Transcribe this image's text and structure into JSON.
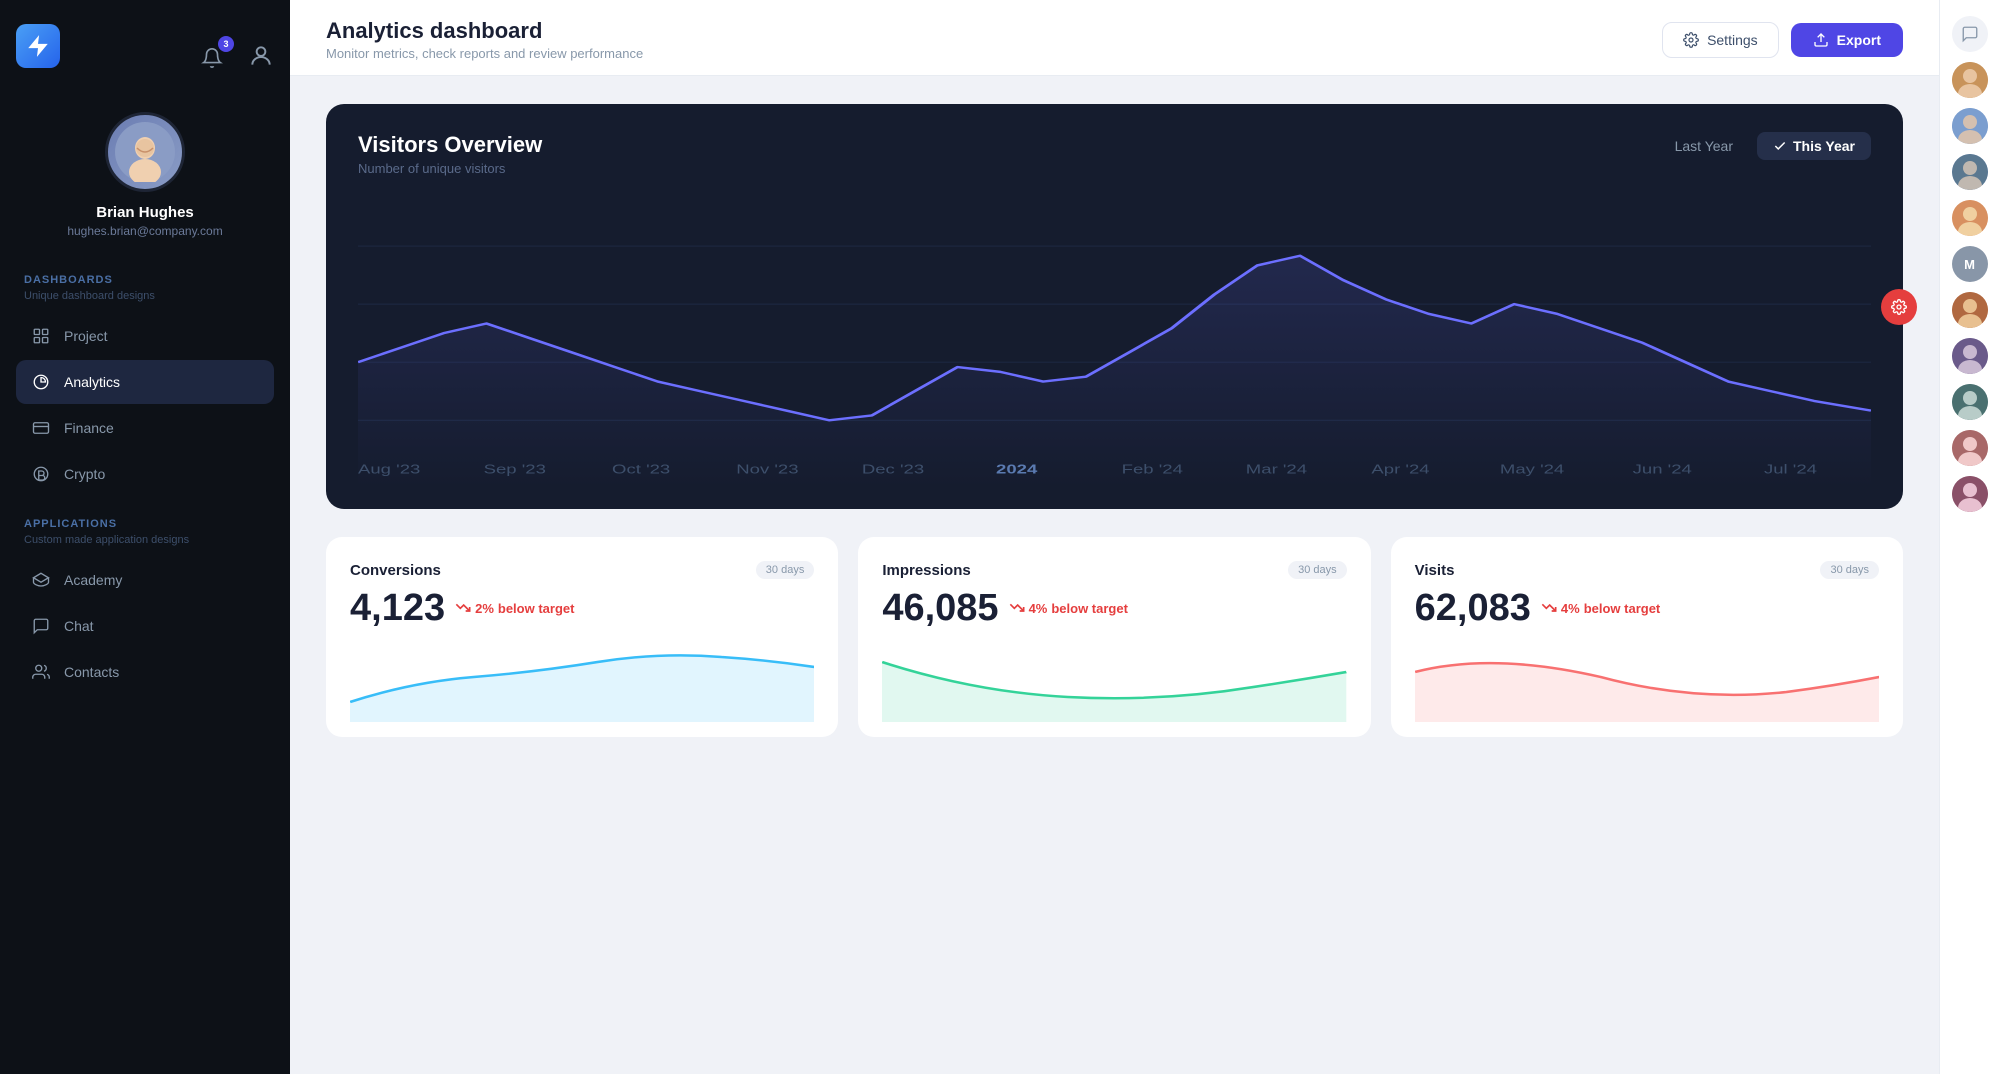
{
  "sidebar": {
    "logo_alt": "App Logo",
    "profile": {
      "name": "Brian Hughes",
      "email": "hughes.brian@company.com"
    },
    "dashboards_label": "DASHBOARDS",
    "dashboards_sub": "Unique dashboard designs",
    "applications_label": "APPLICATIONS",
    "applications_sub": "Custom made application designs",
    "nav_items": [
      {
        "id": "project",
        "label": "Project",
        "icon": "grid-icon"
      },
      {
        "id": "analytics",
        "label": "Analytics",
        "icon": "chart-icon",
        "active": true
      },
      {
        "id": "finance",
        "label": "Finance",
        "icon": "finance-icon"
      },
      {
        "id": "crypto",
        "label": "Crypto",
        "icon": "crypto-icon"
      }
    ],
    "app_items": [
      {
        "id": "academy",
        "label": "Academy",
        "icon": "academy-icon"
      },
      {
        "id": "chat",
        "label": "Chat",
        "icon": "chat-icon"
      },
      {
        "id": "contacts",
        "label": "Contacts",
        "icon": "contacts-icon"
      }
    ],
    "notification_count": "3"
  },
  "header": {
    "title": "Analytics dashboard",
    "subtitle": "Monitor metrics, check reports and review performance",
    "settings_label": "Settings",
    "export_label": "Export"
  },
  "chart": {
    "title": "Visitors Overview",
    "subtitle": "Number of unique visitors",
    "filter_last_year": "Last Year",
    "filter_this_year": "This Year",
    "x_labels": [
      "Aug '23",
      "Sep '23",
      "Oct '23",
      "Nov '23",
      "Dec '23",
      "2024",
      "Feb '24",
      "Mar '24",
      "Apr '24",
      "May '24",
      "Jun '24",
      "Jul '24"
    ]
  },
  "stats": [
    {
      "id": "conversions",
      "label": "Conversions",
      "badge": "30 days",
      "value": "4,123",
      "trend_pct": "2%",
      "trend_label": "below target",
      "chart_color": "#38bdf8",
      "chart_fill": "rgba(56,189,248,0.15)"
    },
    {
      "id": "impressions",
      "label": "Impressions",
      "badge": "30 days",
      "value": "46,085",
      "trend_pct": "4%",
      "trend_label": "below target",
      "chart_color": "#34d399",
      "chart_fill": "rgba(52,211,153,0.15)"
    },
    {
      "id": "visits",
      "label": "Visits",
      "badge": "30 days",
      "value": "62,083",
      "trend_pct": "4%",
      "trend_label": "below target",
      "chart_color": "#f87171",
      "chart_fill": "rgba(248,113,113,0.15)"
    }
  ],
  "right_panel": {
    "chat_icon": "💬",
    "avatars": [
      {
        "id": "a1",
        "color": "#c8935a",
        "initials": ""
      },
      {
        "id": "a2",
        "color": "#7b9ecf",
        "initials": ""
      },
      {
        "id": "a3",
        "color": "#6b8abd",
        "initials": ""
      },
      {
        "id": "a4",
        "color": "#e8a87c",
        "initials": ""
      },
      {
        "id": "a5",
        "color": "#8896a8",
        "initials": "M"
      },
      {
        "id": "a6",
        "color": "#c07850",
        "initials": ""
      },
      {
        "id": "a7",
        "color": "#7a6a9a",
        "initials": ""
      },
      {
        "id": "a8",
        "color": "#5a8080",
        "initials": ""
      },
      {
        "id": "a9",
        "color": "#b87878",
        "initials": ""
      },
      {
        "id": "a10",
        "color": "#9a6078",
        "initials": ""
      }
    ]
  }
}
